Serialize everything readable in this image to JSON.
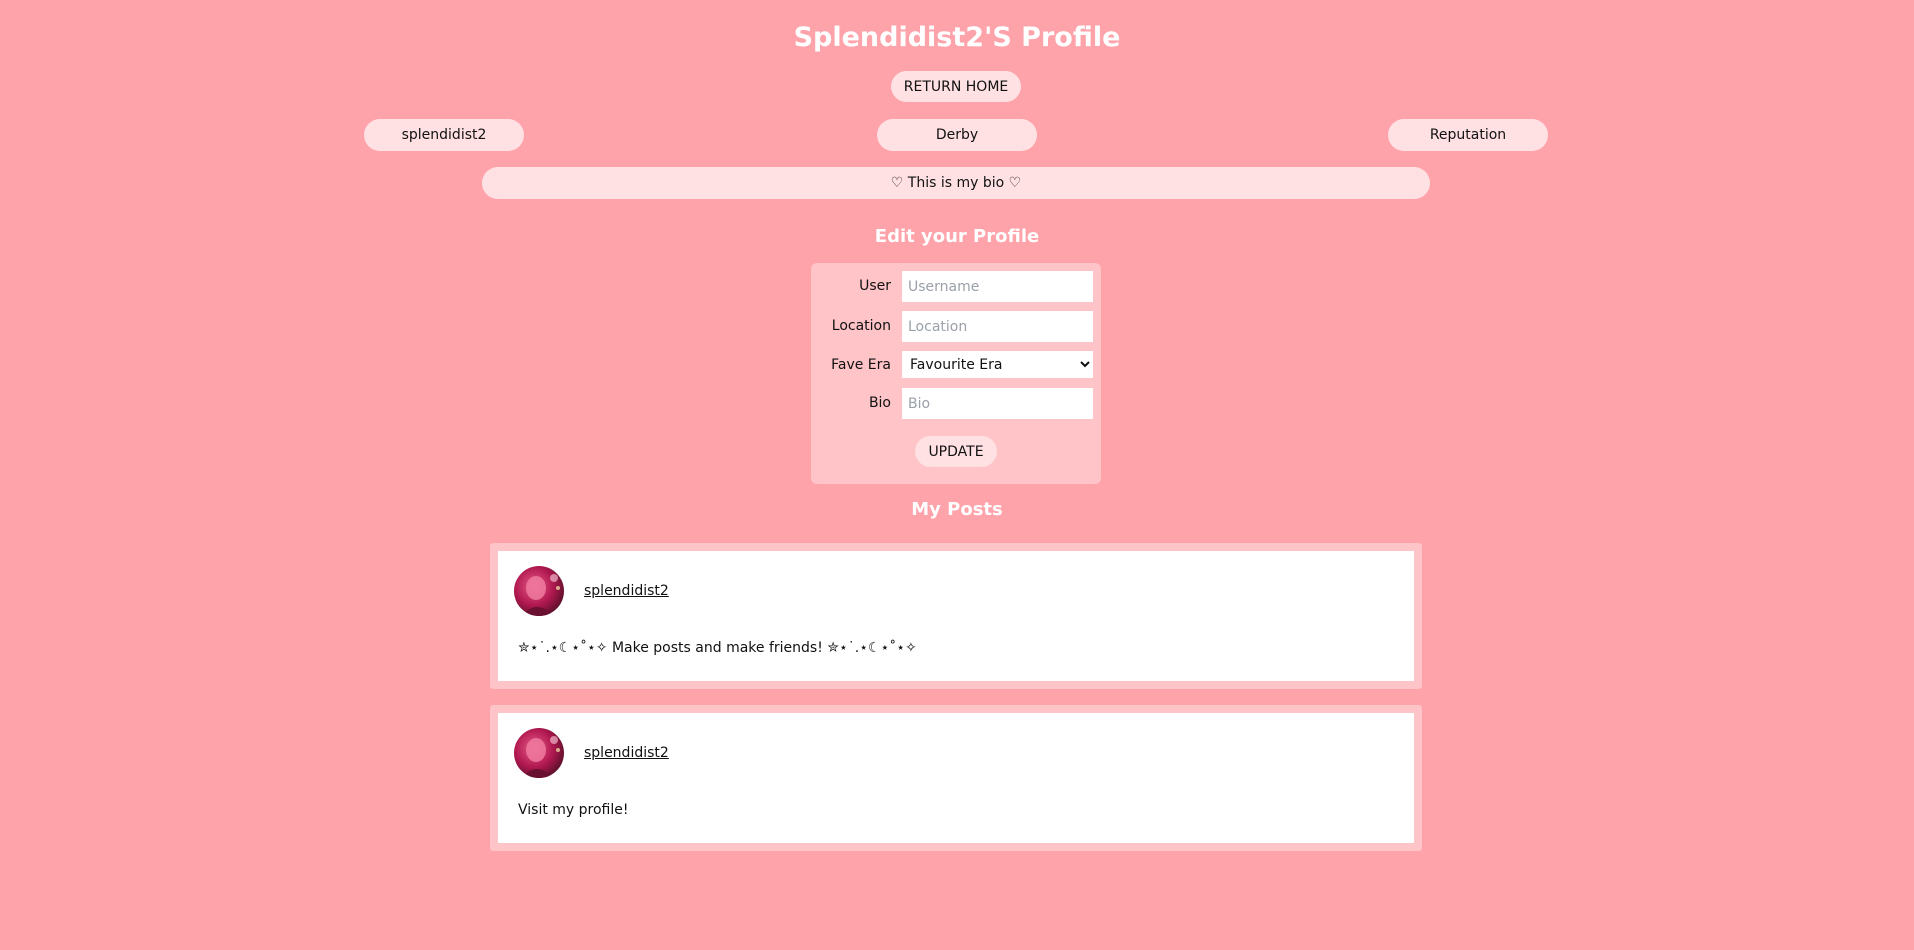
{
  "header": {
    "title": "Splendidist2'S Profile",
    "home_label": "RETURN HOME"
  },
  "profile": {
    "username": "splendidist2",
    "location": "Derby",
    "reputation_label": "Reputation",
    "bio": "♡ This is my bio ♡"
  },
  "edit_form": {
    "title": "Edit your Profile",
    "user_label": "User",
    "user_placeholder": "Username",
    "location_label": "Location",
    "location_placeholder": "Location",
    "era_label": "Fave Era",
    "era_selected": "Favourite Era",
    "bio_label": "Bio",
    "bio_placeholder": "Bio",
    "update_label": "UPDATE"
  },
  "posts_section": {
    "title": "My Posts",
    "posts": [
      {
        "author": "splendidist2",
        "text": "✮⋆˙.⋆☾⋆˚⋆✧ Make posts and make friends! ✮⋆˙.⋆☾⋆˚⋆✧"
      },
      {
        "author": "splendidist2",
        "text": "Visit my profile!"
      }
    ]
  },
  "colors": {
    "background": "#ffa3ab",
    "pill": "#ffe1e3",
    "panel": "#ffc4c8"
  }
}
